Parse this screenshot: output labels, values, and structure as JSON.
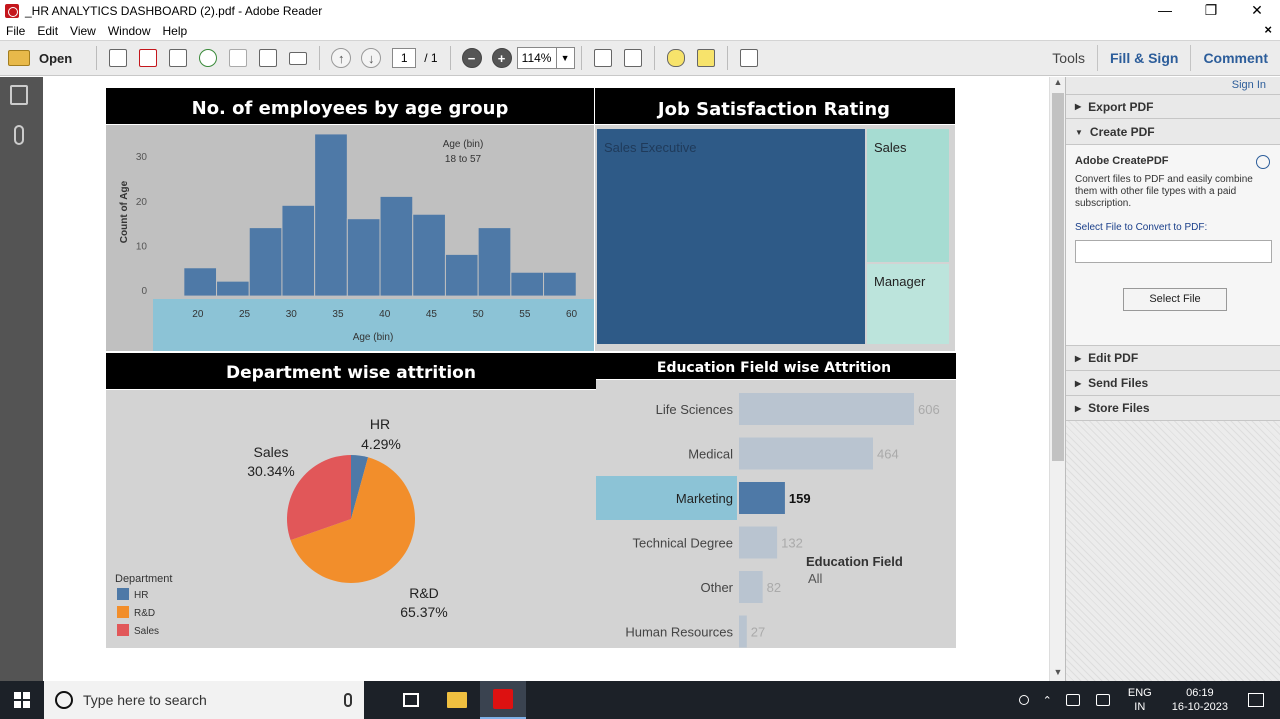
{
  "window": {
    "title": "_HR ANALYTICS DASHBOARD (2).pdf - Adobe Reader",
    "controls": [
      "—",
      "❐",
      "✕"
    ]
  },
  "menu": {
    "items": [
      "File",
      "Edit",
      "View",
      "Window",
      "Help"
    ],
    "close_doc": "×"
  },
  "toolbar": {
    "open_label": "Open",
    "page_current": "1",
    "page_total": "/ 1",
    "zoom": "114%",
    "zoom_minus": "−",
    "zoom_plus": "+",
    "tools_label": "Tools",
    "fill_sign_label": "Fill & Sign",
    "comment_label": "Comment"
  },
  "dashboard": {
    "age_panel": {
      "title": "No. of employees by age group",
      "legend_title": "Age (bin)",
      "legend_range": "18 to 57"
    },
    "job_panel": {
      "title": "Job Satisfaction Rating",
      "cells": [
        "Sales Executive",
        "Sales",
        "Manager"
      ]
    },
    "dept_panel": {
      "title": "Department wise attrition",
      "legend_title": "Department",
      "labels": [
        {
          "name": "HR",
          "pct": "4.29%"
        },
        {
          "name": "Sales",
          "pct": "30.34%"
        },
        {
          "name": "R&D",
          "pct": "65.37%"
        }
      ]
    },
    "edu_panel": {
      "title": "Education Field wise Attrition",
      "filter_title": "Education Field",
      "filter_value": "All"
    }
  },
  "chart_data": [
    {
      "type": "bar",
      "title": "No. of employees by age group",
      "xlabel": "Age (bin)",
      "ylabel": "Count of Age",
      "x_ticks": [
        20,
        25,
        30,
        35,
        40,
        45,
        50,
        55,
        60
      ],
      "y_ticks": [
        0,
        10,
        20,
        30
      ],
      "ylim": [
        -2,
        37
      ],
      "xlim": [
        15.2,
        62.4
      ],
      "bins": [
        {
          "start": 18.5,
          "end": 22,
          "value": 5
        },
        {
          "start": 22,
          "end": 25.5,
          "value": 2
        },
        {
          "start": 25.5,
          "end": 29,
          "value": 14
        },
        {
          "start": 29,
          "end": 32.5,
          "value": 19
        },
        {
          "start": 32.5,
          "end": 36,
          "value": 35
        },
        {
          "start": 36,
          "end": 39.5,
          "value": 16
        },
        {
          "start": 39.5,
          "end": 43,
          "value": 21
        },
        {
          "start": 43,
          "end": 46.5,
          "value": 17
        },
        {
          "start": 46.5,
          "end": 50,
          "value": 8
        },
        {
          "start": 50,
          "end": 53.5,
          "value": 14
        },
        {
          "start": 53.5,
          "end": 57,
          "value": 4
        },
        {
          "start": 57,
          "end": 60.5,
          "value": 4
        }
      ]
    },
    {
      "type": "heatmap",
      "title": "Job Satisfaction Rating",
      "series": [
        {
          "name": "Sales Executive",
          "weight": 0.72
        },
        {
          "name": "Sales",
          "weight": 0.17
        },
        {
          "name": "Manager",
          "weight": 0.11
        }
      ]
    },
    {
      "type": "pie",
      "title": "Department wise attrition",
      "categories": [
        "HR",
        "R&D",
        "Sales"
      ],
      "values": [
        4.29,
        65.37,
        30.34
      ],
      "colors": [
        "#4e79a7",
        "#f28e2b",
        "#e15759"
      ]
    },
    {
      "type": "bar",
      "title": "Education Field wise Attrition",
      "categories": [
        "Life Sciences",
        "Medical",
        "Marketing",
        "Technical Degree",
        "Other",
        "Human Resources"
      ],
      "values": [
        606,
        464,
        159,
        132,
        82,
        27
      ],
      "highlighted": "Marketing"
    }
  ],
  "right_pane": {
    "sign_in": "Sign In",
    "sections": [
      "Export PDF",
      "Create PDF",
      "Edit PDF",
      "Send Files",
      "Store Files"
    ],
    "create_title": "Adobe CreatePDF",
    "create_desc": "Convert files to PDF and easily combine them with other file types with a paid subscription.",
    "select_label": "Select File to Convert to PDF:",
    "select_button": "Select File"
  },
  "taskbar": {
    "search_placeholder": "Type here to search",
    "lang_top": "ENG",
    "lang_bottom": "IN",
    "time": "06:19",
    "date": "16-10-2023"
  },
  "colors": {
    "bar_blue": "#4e79a7",
    "treemap_dark": "#2e5a87",
    "treemap_light": "#a6dcd2",
    "axis_band": "#8cc3d6",
    "edu_bar": "#b9c4d0",
    "edu_highlight": "#4e79a7",
    "link_blue": "#2c5d9a"
  }
}
